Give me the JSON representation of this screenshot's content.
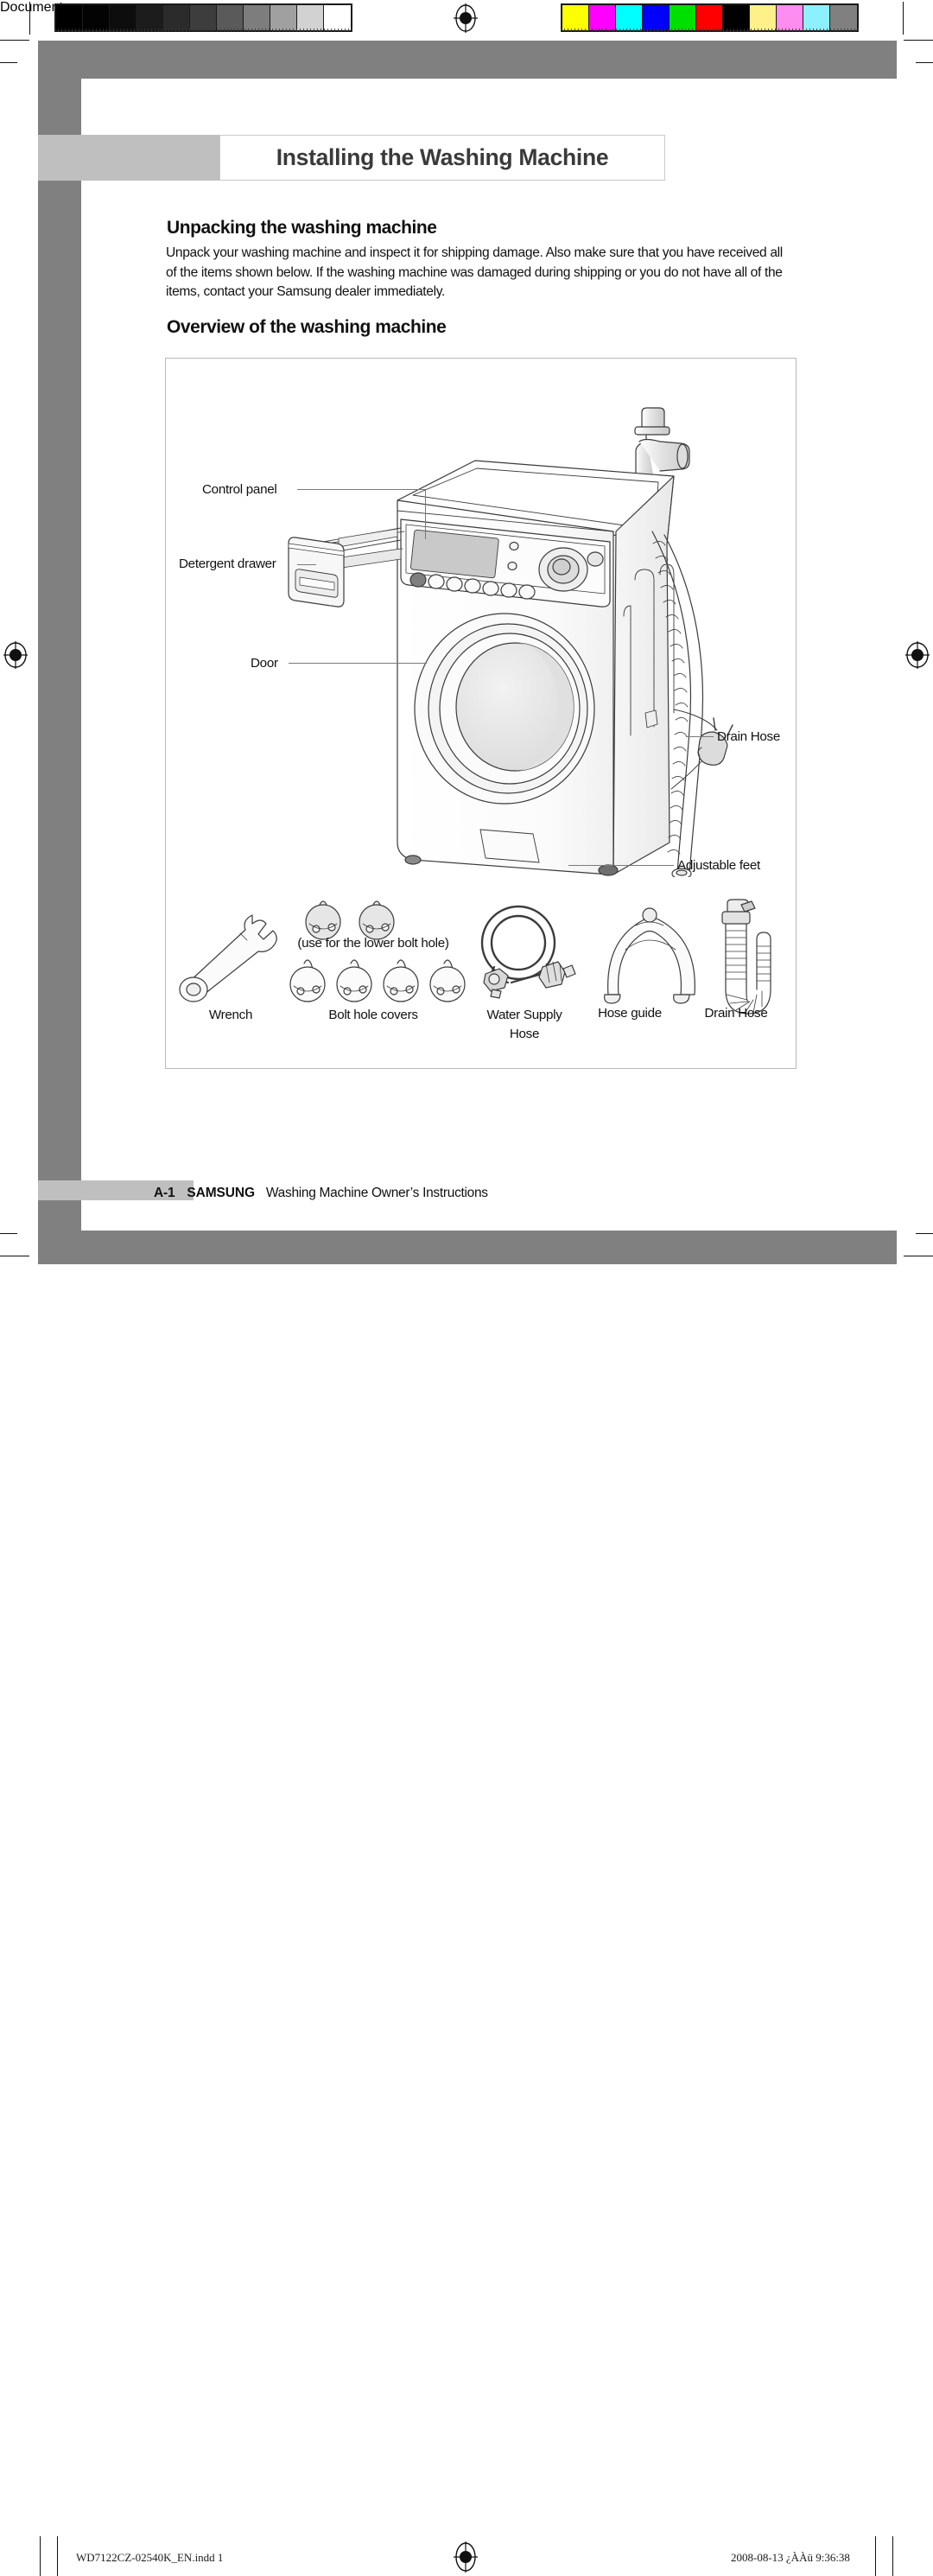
{
  "calibration": {
    "grayscale_swatches": [
      "#000000",
      "#030303",
      "#0d0d0d",
      "#1c1c1c",
      "#2b2b2b",
      "#3d3d3d",
      "#5a5a5a",
      "#7d7d7d",
      "#a0a0a0",
      "#d2d2d2",
      "#ffffff"
    ],
    "color_swatches": [
      "#ffff00",
      "#ff00ff",
      "#00ffff",
      "#0000ff",
      "#00e000",
      "#ff0000",
      "#000000",
      "#fff18a",
      "#ff8cf0",
      "#8cf0ff",
      "#808080"
    ]
  },
  "chapter": {
    "title": "Installing the Washing Machine"
  },
  "sections": {
    "unpacking_heading": "Unpacking the washing machine",
    "unpacking_body": "Unpack your washing machine and inspect it for shipping damage. Also make sure that you have received all of the items shown below. If the washing machine was damaged during shipping or you do not have all of the items, contact your Samsung dealer immediately.",
    "overview_heading": "Overview of the washing machine"
  },
  "diagram": {
    "labels": {
      "control_panel": "Control panel",
      "detergent_drawer": "Detergent drawer",
      "door": "Door",
      "drain_hose": "Drain Hose",
      "adjustable_feet": "Adjustable feet"
    },
    "accessories": [
      {
        "caption": "Wrench"
      },
      {
        "caption": "Bolt hole covers",
        "note": "(use for the lower bolt hole)"
      },
      {
        "caption": "Water Supply\nHose",
        "line1": "Water Supply",
        "line2": "Hose"
      },
      {
        "caption": "Hose guide"
      },
      {
        "caption": "Drain Hose"
      }
    ]
  },
  "footer": {
    "page": "A-1",
    "brand": "SAMSUNG",
    "doc_title": "Washing Machine Owner’s Instructions"
  },
  "print_meta": {
    "file": "WD7122CZ-02540K_EN.indd   1",
    "timestamp": "2008-08-13   ¿ÀÀü 9:36:38"
  },
  "colors": {
    "band_dark": "#808080",
    "band_light": "#bfbfbf",
    "title_text": "#3a3a3a",
    "rule": "#7a7a7a"
  }
}
